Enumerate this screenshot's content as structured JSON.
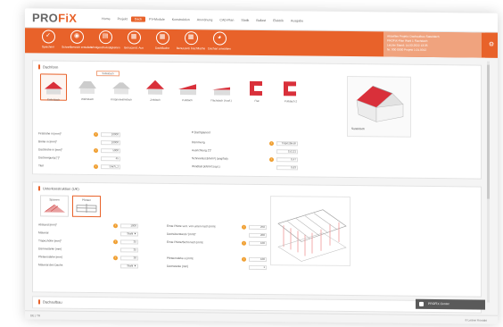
{
  "app": {
    "logo_pro": "PRO",
    "logo_fix": "FiX"
  },
  "menu": [
    "Home",
    "Projekt",
    "Dach",
    "PV-Module",
    "Konstruktion",
    "Anordnung",
    "CAD-Plan",
    "Statik",
    "Ballast",
    "Elektrik",
    "Ausgabe"
  ],
  "menu_active": 2,
  "ribbon": [
    {
      "icon": "✓",
      "label": "Speichern"
    },
    {
      "icon": "◉",
      "label": "Schnellbereich erstellen"
    },
    {
      "icon": "▤",
      "label": "Windgeschwindigkeiten"
    },
    {
      "icon": "▦",
      "label": "Benutzerd. Aus"
    },
    {
      "icon": "▦",
      "label": "Dachflache"
    },
    {
      "icon": "▦",
      "label": "Benutzerd. Dachflache"
    },
    {
      "icon": "◕",
      "label": "Dachart anwahlen"
    }
  ],
  "infobox": [
    "Aktuelles Projekt: Dachaufbau Satteldach",
    "PROFiX-Plan Wahl 1 Flachdach",
    "Letzter Stand: 14.03.2022 13:35",
    "Nr. 000 0000 Projekt 1.01.0012"
  ],
  "corner_icon": "⚙",
  "roof": {
    "title": "Dachform",
    "tooltip": "Satteldach",
    "types": [
      "Satteldach",
      "Walmdach",
      "Krüppelwalmdach",
      "Zeltdach",
      "Pultdach",
      "Flachdach (Ausf.)",
      "Flat",
      "Pultdach 2"
    ],
    "fields": [
      {
        "label": "Firsthöhe in [mm]*",
        "value": "10000"
      },
      {
        "label": "Breite in [mm]*",
        "value": "10000"
      },
      {
        "label": "Dachhöhe in [mm]*",
        "value": "5000"
      },
      {
        "label": "Dachneigung [°]*",
        "value": "45"
      },
      {
        "label": "Titel",
        "value": "Dach_1"
      }
    ],
    "props_header": "Dachpaneel",
    "props": [
      {
        "label": "Dämmung",
        "value": "Trapezblech"
      },
      {
        "label": "Ausrichtung [°]*",
        "value": "152,21"
      },
      {
        "label": "Schneelast [kN/m²] (ang/fab)",
        "value": "0,47"
      },
      {
        "label": "Windlast [kN/m²] (opt.)",
        "value": "0,63"
      }
    ],
    "preview_label": "Satteldach"
  },
  "sub": {
    "title": "Unterkonstruktion (UK)",
    "tabs": [
      "Sparren",
      "Pfetten"
    ],
    "left": [
      {
        "label": "Abstand [mm]*",
        "value": "1000"
      },
      {
        "label": "Material",
        "value": "Stahl ▼"
      },
      {
        "label": "Trapezhöhe [mm]*",
        "value": "35"
      },
      {
        "label": "Dämmstärke [mm]",
        "value": "35"
      },
      {
        "label": "Pfettenstärke [mm]",
        "value": "30"
      },
      {
        "label": "Material des Dachs",
        "value": "Stahl ▼"
      }
    ],
    "right": [
      {
        "label": "Erste Pfette vert. von unten nach [mm]",
        "value": "250"
      },
      {
        "label": "Dachüberstand / [mm]*",
        "value": "200"
      },
      {
        "label": "Erste Pfette/Sicht nach [mm]",
        "value": "100"
      },
      {
        "label": "",
        "value": ""
      },
      {
        "label": "Pfettenstärke a [mm]",
        "value": "100"
      },
      {
        "label": "Dachstärke [mm]",
        "value": "1"
      }
    ]
  },
  "bottom_section": "Dachaufbau",
  "status": {
    "left": "DE | TR",
    "right": "© Leitner Kontakt"
  },
  "notification": "PROFIX Center"
}
